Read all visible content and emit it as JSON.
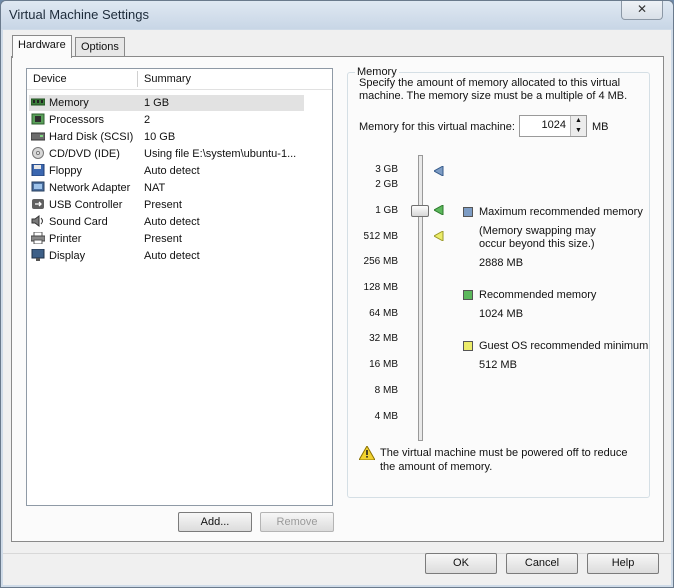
{
  "window": {
    "title": "Virtual Machine Settings",
    "close_glyph": "✕"
  },
  "tabs": [
    {
      "label": "Hardware"
    },
    {
      "label": "Options"
    }
  ],
  "devices": {
    "headers": {
      "device": "Device",
      "summary": "Summary"
    },
    "rows": [
      {
        "name": "Memory",
        "summary": "1 GB",
        "icon": "memory-icon",
        "selected": true
      },
      {
        "name": "Processors",
        "summary": "2",
        "icon": "processor-icon"
      },
      {
        "name": "Hard Disk (SCSI)",
        "summary": "10 GB",
        "icon": "hard-disk-icon"
      },
      {
        "name": "CD/DVD (IDE)",
        "summary": "Using file E:\\system\\ubuntu-1...",
        "icon": "cd-dvd-icon"
      },
      {
        "name": "Floppy",
        "summary": "Auto detect",
        "icon": "floppy-icon"
      },
      {
        "name": "Network Adapter",
        "summary": "NAT",
        "icon": "network-adapter-icon"
      },
      {
        "name": "USB Controller",
        "summary": "Present",
        "icon": "usb-icon"
      },
      {
        "name": "Sound Card",
        "summary": "Auto detect",
        "icon": "sound-card-icon"
      },
      {
        "name": "Printer",
        "summary": "Present",
        "icon": "printer-icon"
      },
      {
        "name": "Display",
        "summary": "Auto detect",
        "icon": "display-icon"
      }
    ],
    "add_label": "Add...",
    "remove_label": "Remove"
  },
  "memory": {
    "group_label": "Memory",
    "description_line1": "Specify the amount of memory allocated to this virtual",
    "description_line2": "machine. The memory size must be a multiple of 4 MB.",
    "field_label": "Memory for this virtual machine:",
    "value": "1024",
    "unit": "MB",
    "scale_labels": [
      "3 GB",
      "2 GB",
      "1 GB",
      "512 MB",
      "256 MB",
      "128 MB",
      "64 MB",
      "32 MB",
      "16 MB",
      "8 MB",
      "4 MB"
    ],
    "legend": {
      "max_label": "Maximum recommended memory",
      "max_note1": "(Memory swapping may",
      "max_note2": "occur beyond this size.)",
      "max_value": "2888 MB",
      "rec_label": "Recommended memory",
      "rec_value": "1024 MB",
      "min_label": "Guest OS recommended minimum",
      "min_value": "512 MB"
    },
    "warning_line1": "The virtual machine must be powered off to reduce",
    "warning_line2": "the amount of memory.",
    "colors": {
      "max": "#7d9cc4",
      "rec": "#5cb85c",
      "min": "#ecec6a"
    }
  },
  "footer": {
    "ok_label": "OK",
    "cancel_label": "Cancel",
    "help_label": "Help"
  }
}
